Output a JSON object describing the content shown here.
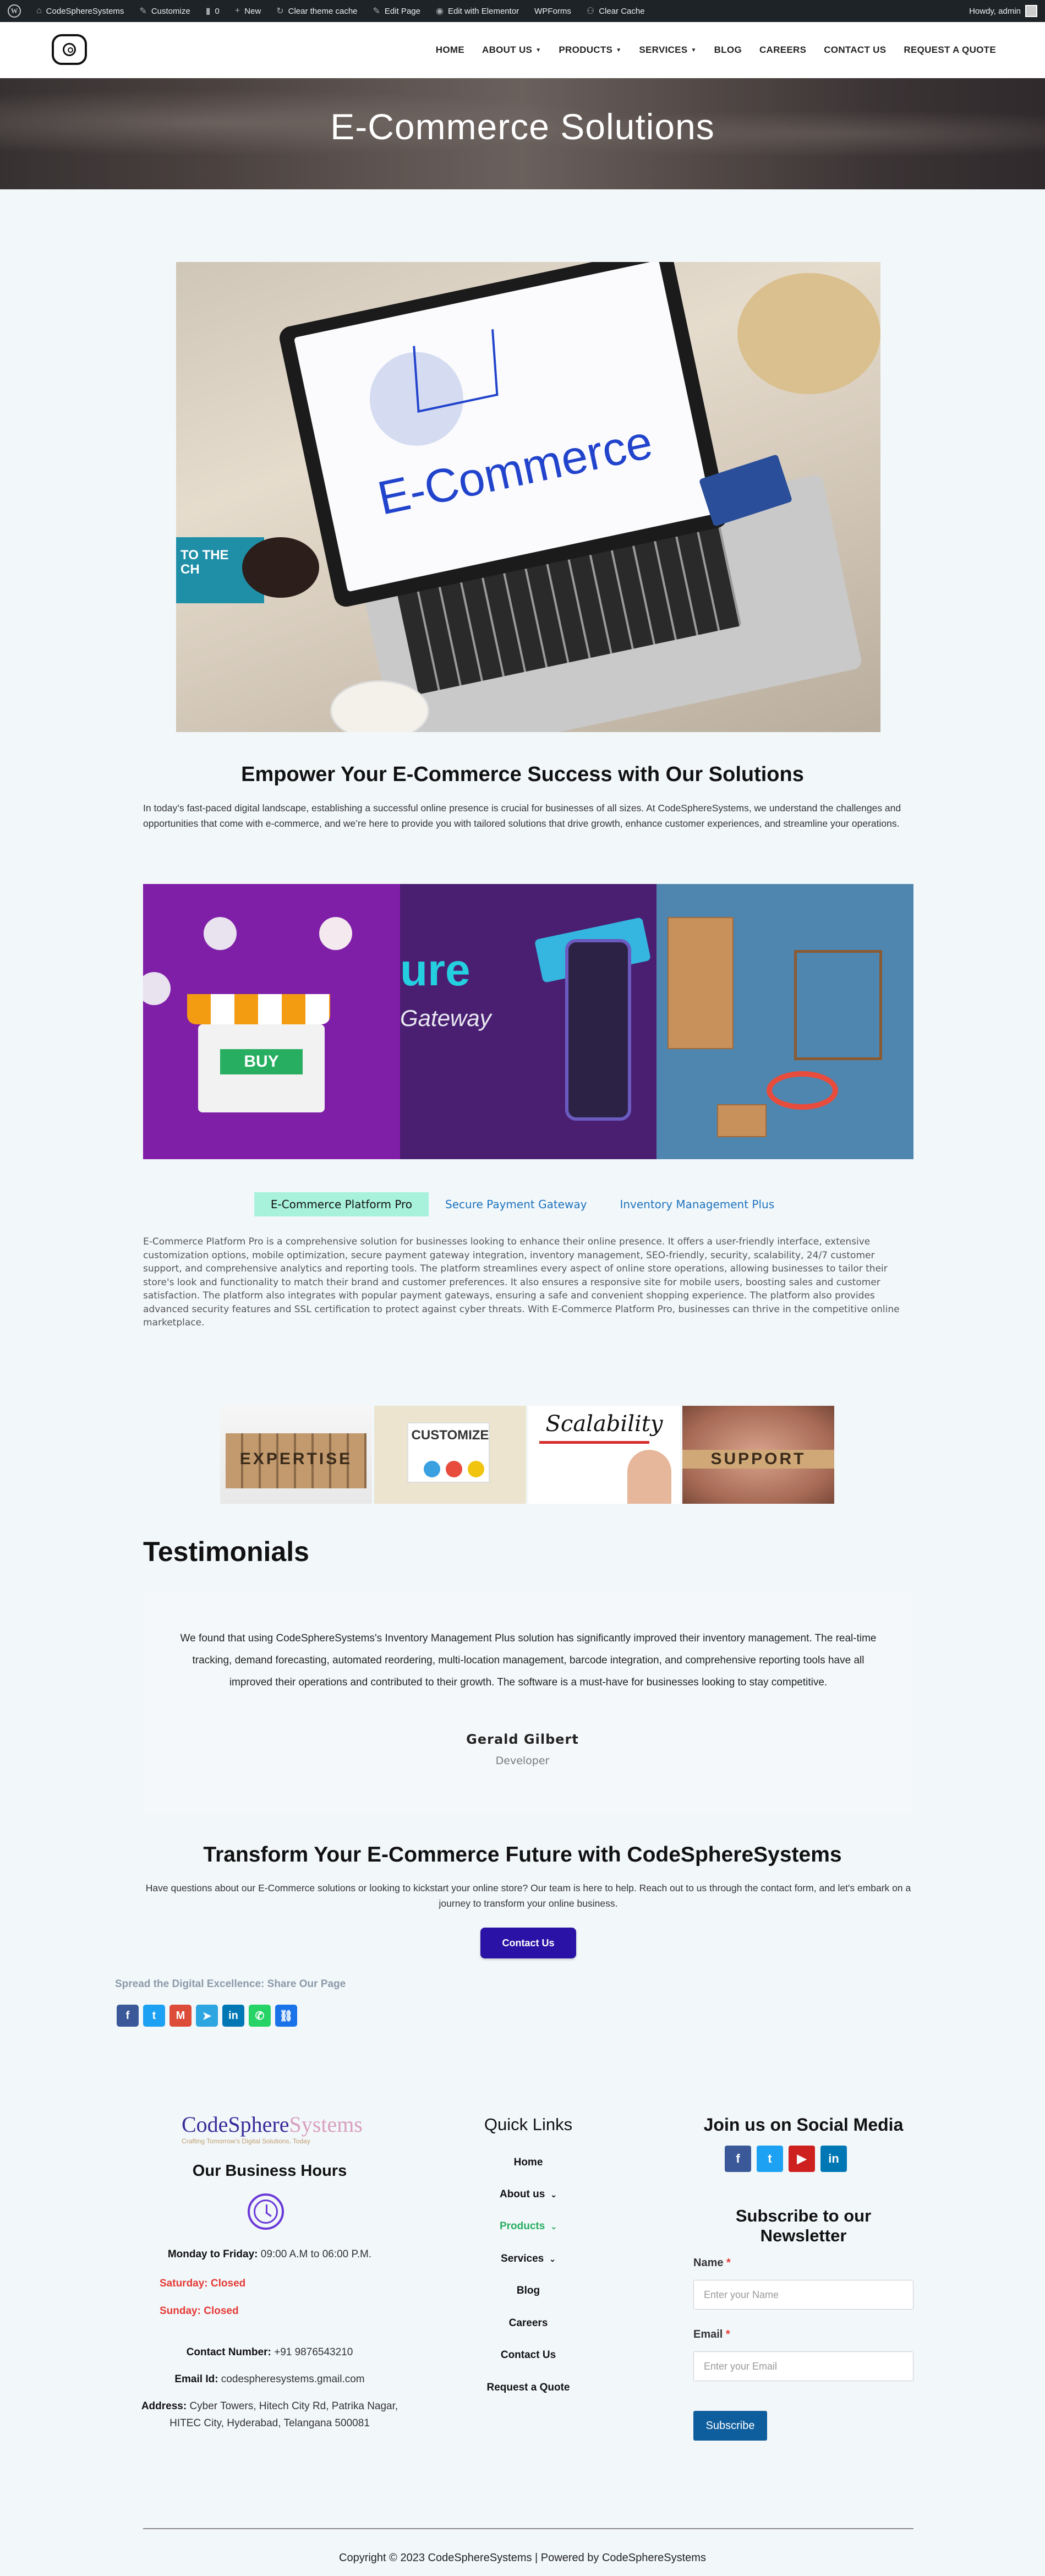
{
  "admin_bar": {
    "site_name": "CodeSphereSystems",
    "customize": "Customize",
    "comments_count": "0",
    "new_label": "New",
    "clear_theme_cache": "Clear theme cache",
    "edit_page": "Edit Page",
    "edit_elementor": "Edit with Elementor",
    "wpforms": "WPForms",
    "clear_cache": "Clear Cache",
    "howdy": "Howdy, admin"
  },
  "nav": {
    "items": [
      {
        "label": "HOME",
        "dropdown": false
      },
      {
        "label": "ABOUT US",
        "dropdown": true
      },
      {
        "label": "PRODUCTS",
        "dropdown": true
      },
      {
        "label": "SERVICES",
        "dropdown": true
      },
      {
        "label": "BLOG",
        "dropdown": false
      },
      {
        "label": "CAREERS",
        "dropdown": false
      },
      {
        "label": "CONTACT US",
        "dropdown": false
      },
      {
        "label": "REQUEST A QUOTE",
        "dropdown": false
      }
    ]
  },
  "hero": {
    "title": "E-Commerce Solutions"
  },
  "main_image": {
    "screen_text": "E-Commerce",
    "book_text": "TO THE\nCH"
  },
  "intro": {
    "heading": "Empower Your E-Commerce Success with Our Solutions",
    "body": "In today’s fast-paced digital landscape, establishing a successful online presence is crucial for businesses of all sizes. At CodeSphereSystems, we understand the challenges and opportunities that come with e-commerce, and we’re here to provide you with tailored solutions that drive growth, enhance customer experiences, and streamline your operations."
  },
  "banner": {
    "buy_label": "BUY",
    "payment_word": "ure",
    "payment_sub": "Gateway"
  },
  "tabs": {
    "items": [
      "E-Commerce Platform Pro",
      "Secure Payment Gateway",
      "Inventory Management Plus"
    ],
    "active_index": 0,
    "content": "E-Commerce Platform Pro is a comprehensive solution for businesses looking to enhance their online presence. It offers a user-friendly interface, extensive customization options, mobile optimization, secure payment gateway integration, inventory management, SEO-friendly, security, scalability, 24/7 customer support, and comprehensive analytics and reporting tools. The platform streamlines every aspect of online store operations, allowing businesses to tailor their store's look and functionality to match their brand and customer preferences. It also ensures a responsive site for mobile users, boosting sales and customer satisfaction. The platform also integrates with popular payment gateways, ensuring a safe and convenient shopping experience. The platform also provides advanced security features and SSL certification to protect against cyber threats. With E-Commerce Platform Pro, businesses can thrive in the competitive online marketplace."
  },
  "features": [
    "EXPERTISE",
    "CUSTOMIZE",
    "Scalability",
    "SUPPORT"
  ],
  "testimonials": {
    "heading": "Testimonials",
    "quote": "We found that using CodeSphereSystems's Inventory Management Plus solution has significantly improved their inventory management. The real-time tracking, demand forecasting, automated reordering, multi-location management, barcode integration, and comprehensive reporting tools have all improved their operations and contributed to their growth. The software is a must-have for businesses looking to stay competitive.",
    "name": "Gerald Gilbert",
    "role": "Developer"
  },
  "cta": {
    "heading": "Transform Your E-Commerce Future with CodeSphereSystems",
    "body": "Have questions about our E-Commerce solutions or looking to kickstart your online store? Our team is here to help. Reach out to us through the contact form, and let's embark on a journey to transform your online business.",
    "button": "Contact Us"
  },
  "share": {
    "title": "Spread the Digital Excellence: Share Our Page",
    "buttons": [
      {
        "name": "facebook",
        "glyph": "f",
        "color": "#3b5998"
      },
      {
        "name": "twitter",
        "glyph": "t",
        "color": "#1da1f2"
      },
      {
        "name": "gmail",
        "glyph": "M",
        "color": "#dd4b39"
      },
      {
        "name": "telegram",
        "glyph": "➤",
        "color": "#2ca5e0"
      },
      {
        "name": "linkedin",
        "glyph": "in",
        "color": "#0077b5"
      },
      {
        "name": "whatsapp",
        "glyph": "✆",
        "color": "#25d366"
      },
      {
        "name": "copy-link",
        "glyph": "⛓",
        "color": "#1a73e8"
      }
    ]
  },
  "footer": {
    "logo_code": "CodeSphere",
    "logo_sys": "Systems",
    "tagline": "Crafting Tomorrow's Digital Solutions, Today",
    "hours_heading": "Our Business Hours",
    "weekday_label": "Monday to Friday:",
    "weekday_value": " 09:00 A.M to 06:00 P.M.",
    "saturday": "Saturday: Closed",
    "sunday": "Sunday: Closed",
    "contact_label": "Contact Number:",
    "contact_value": " +91 9876543210",
    "email_label": "Email Id:",
    "email_value": " codespheresystems.gmail.com",
    "address_label": "Address:",
    "address_value": " Cyber Towers, Hitech City Rd, Patrika Nagar, HITEC City, Hyderabad, Telangana 500081",
    "quick_links_heading": "Quick Links",
    "quick_links": [
      {
        "label": "Home",
        "dropdown": false,
        "active": false
      },
      {
        "label": "About us",
        "dropdown": true,
        "active": false
      },
      {
        "label": "Products",
        "dropdown": true,
        "active": true
      },
      {
        "label": "Services",
        "dropdown": true,
        "active": false
      },
      {
        "label": "Blog",
        "dropdown": false,
        "active": false
      },
      {
        "label": "Careers",
        "dropdown": false,
        "active": false
      },
      {
        "label": "Contact Us",
        "dropdown": false,
        "active": false
      },
      {
        "label": "Request a Quote",
        "dropdown": false,
        "active": false
      }
    ],
    "social_heading": "Join us on Social Media",
    "social": [
      {
        "name": "facebook",
        "glyph": "f",
        "color": "#3b5998"
      },
      {
        "name": "twitter",
        "glyph": "t",
        "color": "#1da1f2"
      },
      {
        "name": "youtube",
        "glyph": "▶",
        "color": "#cd201f"
      },
      {
        "name": "linkedin",
        "glyph": "in",
        "color": "#0077b5"
      }
    ],
    "newsletter_heading": "Subscribe to our Newsletter",
    "name_label": "Name",
    "name_placeholder": "Enter your Name",
    "email_field_label": "Email",
    "email_placeholder": "Enter your Email",
    "subscribe": "Subscribe",
    "required_mark": "*",
    "copyright": "Copyright © 2023 CodeSphereSystems | Powered by CodeSphereSystems"
  }
}
